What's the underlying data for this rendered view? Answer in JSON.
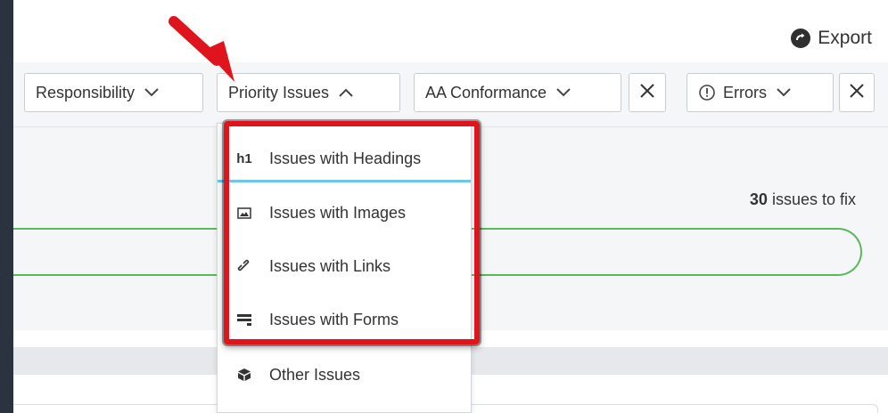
{
  "toolbar": {
    "export_label": "Export"
  },
  "filters": {
    "responsibility": "Responsibility",
    "priority_issues": "Priority Issues",
    "conformance": "AA Conformance",
    "errors": "Errors"
  },
  "summary": {
    "count": "30",
    "count_suffix": " issues to fix"
  },
  "menu": {
    "items": [
      {
        "icon_text": "h1",
        "icon": "heading-icon",
        "label": "Issues with Headings"
      },
      {
        "icon": "image-icon",
        "label": "Issues with Images"
      },
      {
        "icon": "link-icon",
        "label": "Issues with Links"
      },
      {
        "icon": "form-icon",
        "label": "Issues with Forms"
      },
      {
        "icon": "box-icon",
        "label": "Other Issues"
      }
    ]
  },
  "annotation": {
    "highlight_color": "#e0141c",
    "arrow_color": "#e0141c"
  }
}
